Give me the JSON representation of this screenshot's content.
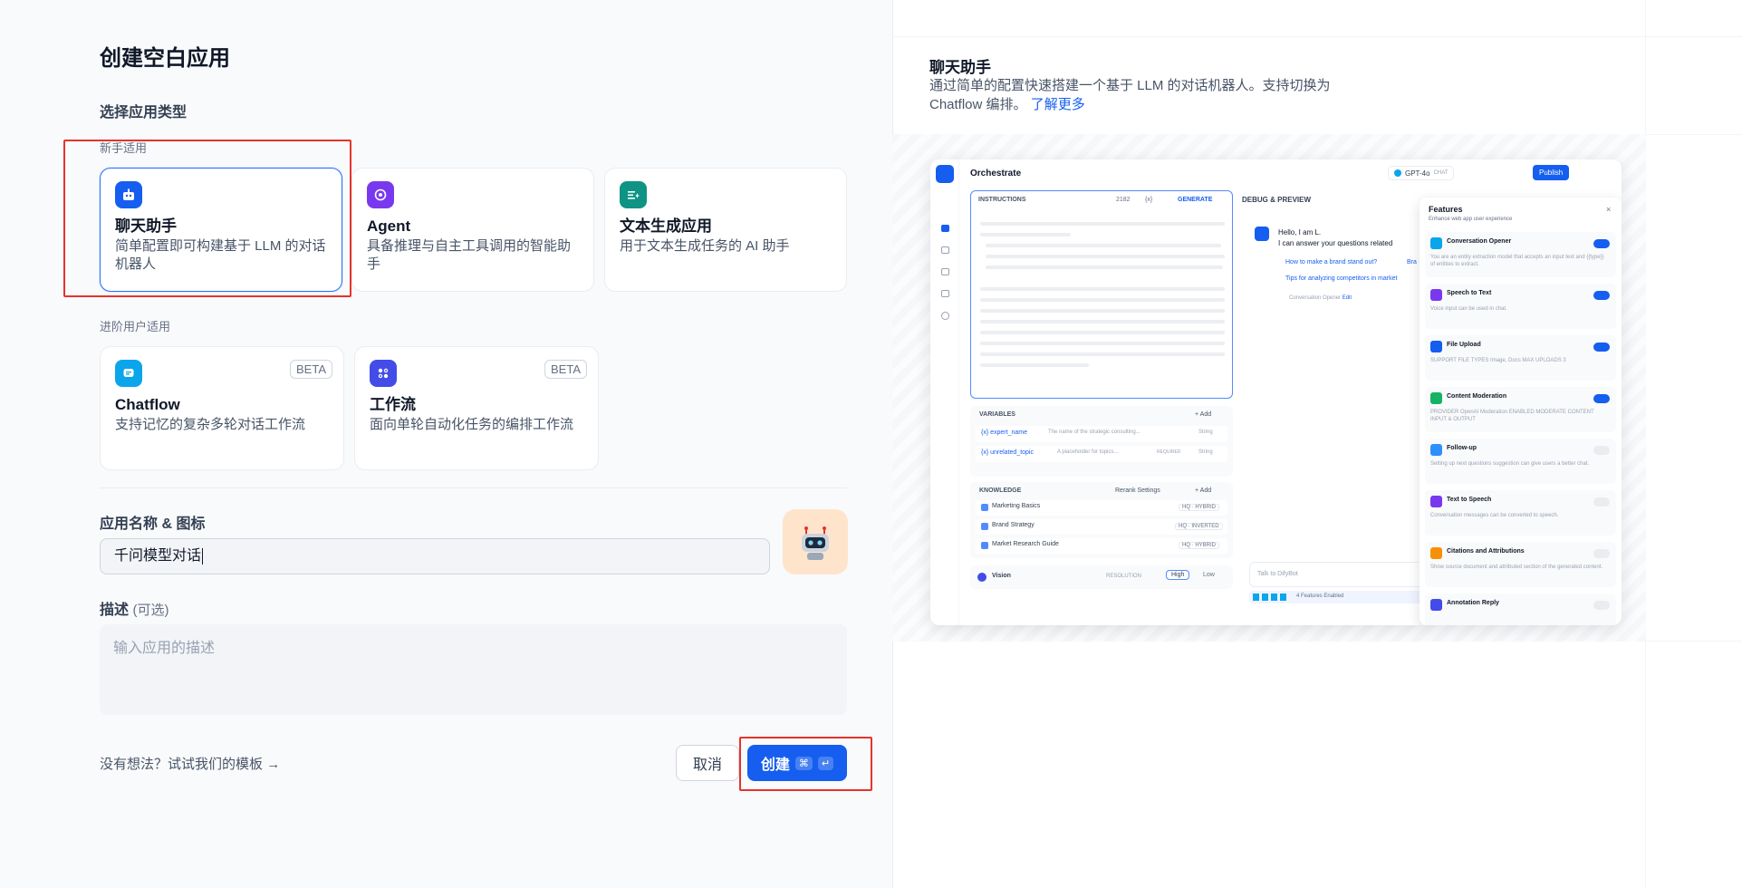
{
  "page": {
    "title": "创建空白应用",
    "section_app_type": "选择应用类型"
  },
  "groups": {
    "beginner": "新手适用",
    "advanced": "进阶用户适用"
  },
  "app_types": [
    {
      "name": "聊天助手",
      "desc": "简单配置即可构建基于 LLM 的对话机器人",
      "icon": "chat-bot-icon",
      "color": "#155eef",
      "selected": true
    },
    {
      "name": "Agent",
      "desc": "具备推理与自主工具调用的智能助手",
      "icon": "agent-icon",
      "color": "#7839ee"
    },
    {
      "name": "文本生成应用",
      "desc": "用于文本生成任务的 AI 助手",
      "icon": "text-generation-icon",
      "color": "#0e9384"
    },
    {
      "name": "Chatflow",
      "desc": "支持记忆的复杂多轮对话工作流",
      "icon": "chatflow-icon",
      "color": "#0ba5ec",
      "badge": "BETA"
    },
    {
      "name": "工作流",
      "desc": "面向单轮自动化任务的编排工作流",
      "icon": "workflow-icon",
      "color": "#444ce7",
      "badge": "BETA"
    }
  ],
  "form": {
    "name_label": "应用名称 & 图标",
    "name_value": "千问模型对话",
    "desc_label": "描述",
    "desc_optional": "(可选)",
    "desc_placeholder": "输入应用的描述"
  },
  "footer": {
    "template_link": "没有想法？试试我们的模板",
    "cancel": "取消",
    "create": "创建",
    "create_kbd": [
      "⌘",
      "↵"
    ]
  },
  "preview": {
    "title": "聊天助手",
    "desc": "通过简单的配置快速搭建一个基于 LLM 的对话机器人。支持切换为 Chatflow 编排。",
    "learn_more": "了解更多",
    "shot": {
      "header": "Orchestrate",
      "model": "GPT-4o",
      "model_tag": "CHAT",
      "publish": "Publish",
      "instructions": "INSTRUCTIONS",
      "instr_count": "2182",
      "instr_var": "{x}",
      "generate": "GENERATE",
      "variables": "VARIABLES",
      "add": "+ Add",
      "vars": [
        {
          "name": "{x} expert_name",
          "desc": "The name of the strategic consulting...",
          "type": "String"
        },
        {
          "name": "{x} unrelated_topic",
          "desc": "A placeholder for topics...",
          "req": "REQUIRED",
          "type": "String"
        }
      ],
      "knowledge": "KNOWLEDGE",
      "rerank": "Rerank Settings",
      "docs": [
        {
          "name": "Marketing Basics",
          "tag": "HQ · HYBRID"
        },
        {
          "name": "Brand Strategy",
          "tag": "HQ · INVERTED"
        },
        {
          "name": "Market Research Guide",
          "tag": "HQ · HYBRID"
        }
      ],
      "vision": "Vision",
      "resolution": "RESOLUTION",
      "high": "High",
      "low": "Low",
      "debug": "DEBUG & PREVIEW",
      "greeting1": "Hello, I am L.",
      "greeting2": "I can answer your questions related",
      "sugg1": "How to make a brand stand out?",
      "sugg1b": "Bra",
      "sugg2": "Tips for analyzing competitors in market",
      "opener": "Conversation Opener",
      "edit": "Edit",
      "talk": "Talk to DifyBot",
      "features_enabled": "4 Features Enabled",
      "features_title": "Features",
      "features_sub": "Enhance web app user experience",
      "features": [
        {
          "name": "Conversation Opener",
          "desc": "You are an entity extraction model that accepts an input text and {{type}} of entities to extract.",
          "on": true,
          "color": "#0ba5ec"
        },
        {
          "name": "Speech to Text",
          "desc": "Voice input can be used in chat.",
          "on": true,
          "color": "#7839ee"
        },
        {
          "name": "File Upload",
          "desc": "SUPPORT FILE TYPES  Image, Docs    MAX UPLOADS  3",
          "on": true,
          "color": "#155eef"
        },
        {
          "name": "Content Moderation",
          "desc": "PROVIDER  OpenAI Moderation    ENABLED MODERATE CONTENT  INPUT & OUTPUT",
          "on": true,
          "color": "#16b364"
        },
        {
          "name": "Follow-up",
          "desc": "Setting up next questions suggestion can give users a better chat.",
          "on": false,
          "color": "#2e90fa"
        },
        {
          "name": "Text to Speech",
          "desc": "Conversation messages can be converted to speech.",
          "on": false,
          "color": "#7839ee"
        },
        {
          "name": "Citations and Attributions",
          "desc": "Show source document and attributed section of the generated content.",
          "on": false,
          "color": "#f79009"
        },
        {
          "name": "Annotation Reply",
          "desc": "",
          "on": false,
          "color": "#444ce7"
        }
      ]
    }
  }
}
